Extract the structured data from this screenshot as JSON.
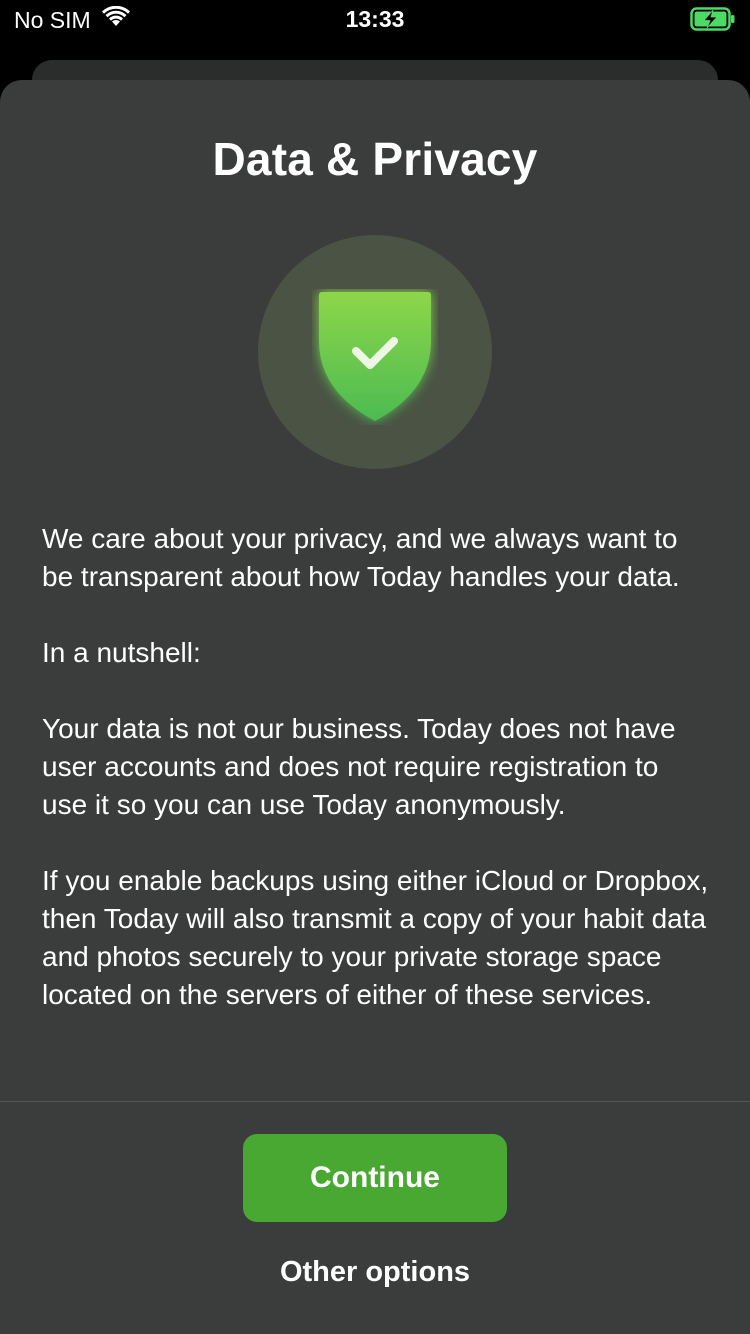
{
  "status_bar": {
    "carrier": "No SIM",
    "time": "13:33",
    "battery_state": "charging",
    "wifi_icon": "wifi-icon",
    "battery_icon": "battery-charging-icon"
  },
  "sheet": {
    "title": "Data & Privacy",
    "badge_icon": "shield-check-icon",
    "paragraphs": [
      "We care about your privacy, and we always want to be transparent about how Today handles your data.",
      "In a nutshell:",
      "Your data is not our business. Today does not have user accounts and does not require registration to use it so you can use Today anonymously.",
      "If you enable backups using either iCloud or Dropbox, then Today will also transmit a copy of your habit data and photos securely to your private storage space located on the servers of either of these services."
    ]
  },
  "actions": {
    "continue_label": "Continue",
    "other_options_label": "Other options"
  },
  "colors": {
    "sheet_background": "#3b3c3c",
    "accent_green": "#48a832",
    "badge_background": "#4a5344"
  }
}
